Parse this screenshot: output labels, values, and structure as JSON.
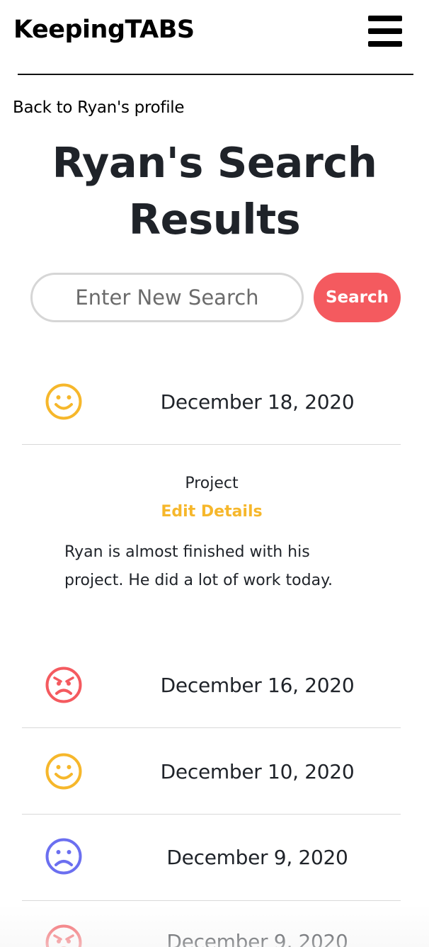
{
  "header": {
    "brand": "KeepingTABS",
    "menu_icon": "hamburger-menu-icon"
  },
  "back_link": "Back to Ryan's profile",
  "page_title": "Ryan's Search Results",
  "search": {
    "placeholder": "Enter New Search",
    "button_label": "Search"
  },
  "colors": {
    "happy": "#f6b72b",
    "angry": "#f45a5f",
    "sad": "#6b6ff0",
    "accent": "#f45a5f",
    "edit_link": "#f6b72b"
  },
  "results": [
    {
      "mood": "happy",
      "icon": "smiley-face-icon",
      "date": "December 18, 2020",
      "expanded": true,
      "category": "Project",
      "edit_label": "Edit Details",
      "note": "Ryan is almost finished with his project. He did a lot of work today."
    },
    {
      "mood": "angry",
      "icon": "angry-face-icon",
      "date": "December 16, 2020"
    },
    {
      "mood": "happy",
      "icon": "smiley-face-icon",
      "date": "December 10, 2020"
    },
    {
      "mood": "sad",
      "icon": "sad-face-icon",
      "date": "December 9, 2020"
    },
    {
      "mood": "angry",
      "icon": "angry-face-icon",
      "date": "December 9, 2020"
    }
  ]
}
